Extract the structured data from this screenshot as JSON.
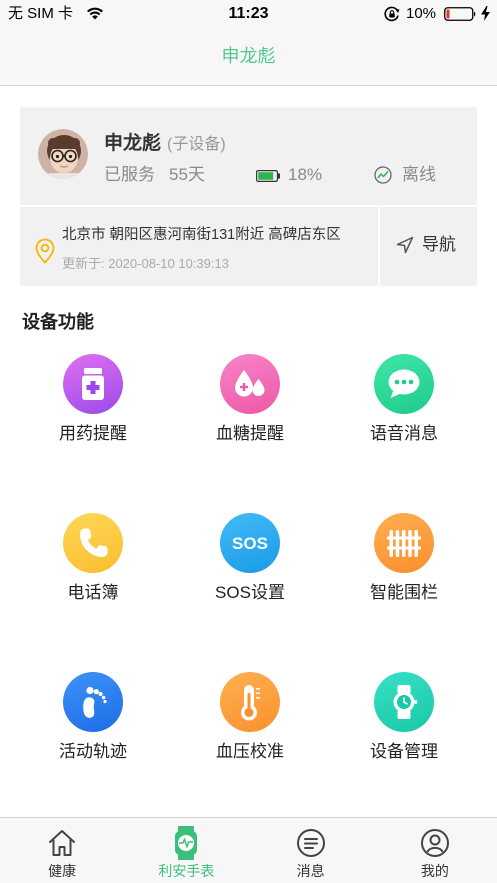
{
  "status_bar": {
    "carrier": "无 SIM 卡",
    "time": "11:23",
    "battery_percent": "10%",
    "icons": [
      "wifi-icon",
      "rotation-lock-icon",
      "battery-low-icon",
      "charging-bolt-icon"
    ]
  },
  "header": {
    "title": "申龙彪"
  },
  "device": {
    "name": "申龙彪",
    "type": "(子设备)",
    "served_label": "已服务",
    "served_days": "55天",
    "battery": "18%",
    "status": "离线",
    "avatar": "child-avatar"
  },
  "location": {
    "address": "北京市 朝阳区惠河南街131附近 高碑店东区",
    "updated": "更新于: 2020-08-10 10:39:13",
    "navigate_label": "导航",
    "icon": "location-pin-icon"
  },
  "functions": {
    "title": "设备功能",
    "items": [
      {
        "label": "用药提醒",
        "icon": "medicine-bottle-icon",
        "colors": [
          "#e070f2",
          "#9a4ae8"
        ]
      },
      {
        "label": "血糖提醒",
        "icon": "blood-drops-icon",
        "colors": [
          "#f884cb",
          "#ec58a5"
        ]
      },
      {
        "label": "语音消息",
        "icon": "chat-bubble-icon",
        "colors": [
          "#3fe6a8",
          "#1fcb8b"
        ]
      },
      {
        "label": "电话簿",
        "icon": "phone-icon",
        "colors": [
          "#ffd75a",
          "#fbbd2e"
        ]
      },
      {
        "label": "SOS设置",
        "icon": "sos-icon",
        "icon_text": "SOS",
        "colors": [
          "#43bbf7",
          "#1a9ae6"
        ]
      },
      {
        "label": "智能围栏",
        "icon": "fence-icon",
        "colors": [
          "#ffaf52",
          "#fa8e2c"
        ]
      },
      {
        "label": "活动轨迹",
        "icon": "footprint-icon",
        "colors": [
          "#3f92f8",
          "#1d6de6"
        ]
      },
      {
        "label": "血压校准",
        "icon": "thermometer-icon",
        "colors": [
          "#ffb052",
          "#fa902e"
        ]
      },
      {
        "label": "设备管理",
        "icon": "watch-icon",
        "colors": [
          "#38e0c6",
          "#19c8a6"
        ]
      }
    ]
  },
  "tabs": [
    {
      "label": "健康",
      "icon": "home-icon",
      "active": false
    },
    {
      "label": "利安手表",
      "icon": "watch-icon",
      "active": true
    },
    {
      "label": "消息",
      "icon": "message-icon",
      "active": false
    },
    {
      "label": "我的",
      "icon": "profile-icon",
      "active": false
    }
  ],
  "colors": {
    "accent": "#3cbf7a",
    "header_title": "#4fc98c",
    "location_pin": "#f5b400",
    "battery_fill": "#2fb34a",
    "low_battery": "#e33333"
  }
}
